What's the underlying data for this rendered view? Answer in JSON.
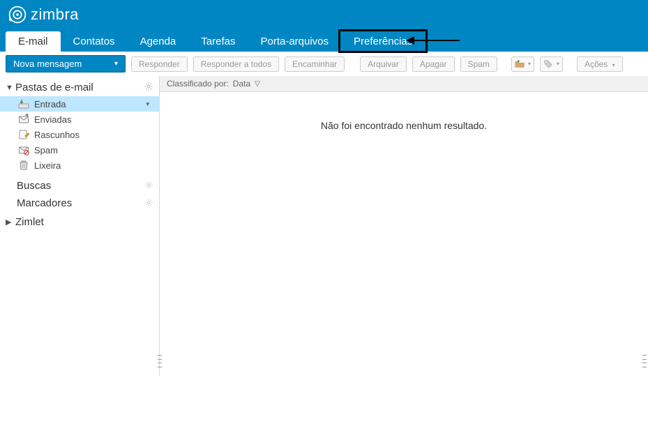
{
  "brand": "zimbra",
  "tabs": [
    {
      "label": "E-mail",
      "active": true
    },
    {
      "label": "Contatos"
    },
    {
      "label": "Agenda"
    },
    {
      "label": "Tarefas"
    },
    {
      "label": "Porta-arquivos"
    },
    {
      "label": "Preferências",
      "highlighted": true
    }
  ],
  "compose": {
    "label": "Nova mensagem"
  },
  "toolbar": {
    "reply": "Responder",
    "reply_all": "Responder a todos",
    "forward": "Encaminhar",
    "archive": "Arquivar",
    "delete": "Apagar",
    "spam": "Spam",
    "actions": "Ações"
  },
  "sidebar": {
    "folders_header": "Pastas de e-mail",
    "folders": [
      {
        "label": "Entrada",
        "selected": true,
        "has_menu": true
      },
      {
        "label": "Enviadas"
      },
      {
        "label": "Rascunhos"
      },
      {
        "label": "Spam"
      },
      {
        "label": "Lixeira"
      }
    ],
    "searches": "Buscas",
    "tags": "Marcadores",
    "zimlet": "Zimlet"
  },
  "content": {
    "sort_label": "Classificado por:",
    "sort_field": "Data",
    "empty": "Não foi encontrado nenhum resultado."
  }
}
